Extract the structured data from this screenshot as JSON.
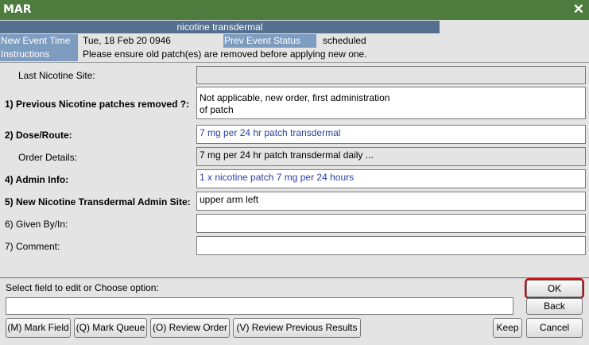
{
  "window": {
    "title": "MAR",
    "close_icon": "close-icon"
  },
  "order": {
    "name": "nicotine transdermal"
  },
  "info": {
    "new_event_time_label": "New Event Time",
    "new_event_time_value": "Tue, 18 Feb 20  0946",
    "prev_event_status_label": "Prev Event Status",
    "prev_event_status_value": "scheduled",
    "instructions_label": "Instructions",
    "instructions_value": "Please ensure old patch(es) are removed before applying new one."
  },
  "form": {
    "last_site": {
      "label": "Last Nicotine Site:",
      "value": ""
    },
    "prev_removed": {
      "label": "1)  Previous Nicotine patches removed ?:",
      "value_line1": "Not applicable, new order, first administration",
      "value_line2": "of patch"
    },
    "dose_route": {
      "label": "2)  Dose/Route:",
      "value": "7 mg per 24 hr patch transdermal"
    },
    "order_details": {
      "label": "Order Details:",
      "value": "7 mg per 24 hr patch transdermal daily ..."
    },
    "admin_info": {
      "label": "4)  Admin Info:",
      "value": "1 x nicotine patch 7 mg per 24 hours"
    },
    "admin_site": {
      "label": "5)  New Nicotine Transdermal Admin Site:",
      "value": "upper arm left"
    },
    "given_by": {
      "label": "6)  Given By/In:",
      "value": ""
    },
    "comment": {
      "label": "7)  Comment:",
      "value": ""
    }
  },
  "bottom": {
    "select_label": "Select field to edit or Choose option:",
    "option_value": "",
    "buttons": {
      "mark_field": "(M) Mark Field",
      "mark_queue": "(Q) Mark Queue",
      "review_order": "(O) Review Order",
      "review_previous": "(V) Review Previous Results",
      "keep": "Keep",
      "cancel": "Cancel",
      "ok": "OK",
      "back": "Back"
    }
  }
}
